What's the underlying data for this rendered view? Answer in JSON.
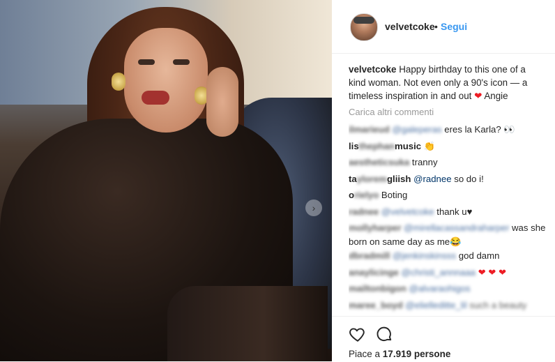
{
  "post": {
    "image_alt_icon": "photo",
    "next_icon": "›"
  },
  "header": {
    "username": "velvetcoke",
    "separator": "•",
    "follow_label": "Segui"
  },
  "caption": {
    "username": "velvetcoke",
    "text": "Happy birthday to this one of a kind woman. Not even only a 90's icon — a timeless inspiration in and out",
    "emoji": "❤",
    "tail": "Angie"
  },
  "load_more_label": "Carica altri commenti",
  "comments": [
    {
      "user": "ilmarieud",
      "mention": "@galeperas",
      "text": "eres la Karla? 👀"
    },
    {
      "user": "lis",
      "user_blur": "thephan",
      "user_tail": "music",
      "text": "👏"
    },
    {
      "user": "aestheticsuka",
      "text": "tranny"
    },
    {
      "user": "ta",
      "user_blur": "ylorem",
      "user_tail": "gliish",
      "mention": "@radnee",
      "text": "so do i!"
    },
    {
      "user": "o",
      "user_blur": "rielyo",
      "text": "Boting"
    },
    {
      "user": "radnee",
      "mention": "@velvetcoke",
      "text": "thank u",
      "emoji": "♥"
    },
    {
      "user": "mollyharper",
      "mention": "@mirellacassandraharper",
      "text": "was she born on same day as me",
      "emoji": "😂"
    },
    {
      "user": "dbradmill",
      "mention": "@jenkinskinsss",
      "text": "god damn"
    },
    {
      "user": "anaylicinge",
      "mention": "@christi_annnaaa",
      "text": "",
      "emoji": "❤ ❤ ❤"
    },
    {
      "user": "mailtonbigon",
      "mention": "@alvaraohigos",
      "text": ""
    },
    {
      "user": "maree_boyd",
      "mention": "@elielleditte_lil",
      "text": "such a beauty"
    }
  ],
  "actions": {
    "like_icon": "heart-outline",
    "comment_icon": "speech-bubble",
    "likes_prefix": "Piace a",
    "likes_count": "17.919",
    "likes_suffix": "persone"
  }
}
